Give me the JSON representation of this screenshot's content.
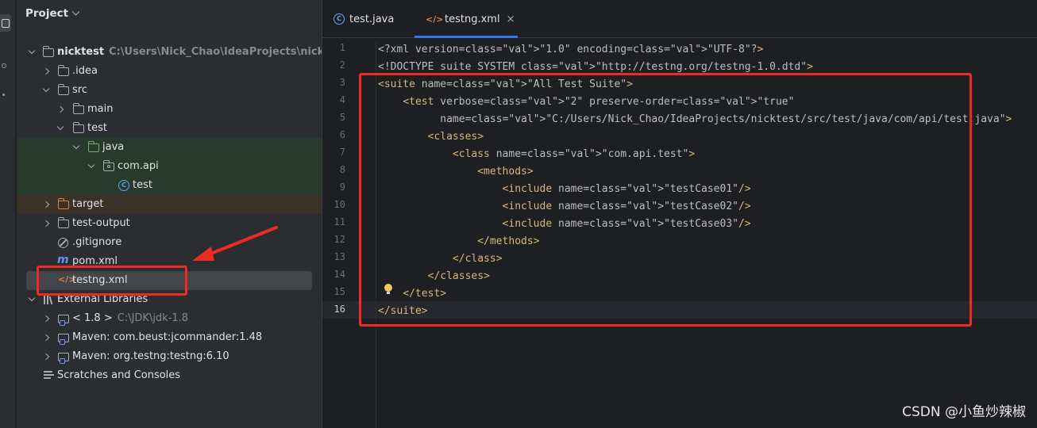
{
  "project_panel": {
    "title": "Project",
    "tree": [
      {
        "label": "nicktest",
        "hint": "C:\\Users\\Nick_Chao\\IdeaProjects\\nicktest"
      },
      {
        "label": ".idea"
      },
      {
        "label": "src"
      },
      {
        "label": "main"
      },
      {
        "label": "test"
      },
      {
        "label": "java"
      },
      {
        "label": "com.api"
      },
      {
        "label": "test"
      },
      {
        "label": "target"
      },
      {
        "label": "test-output"
      },
      {
        "label": ".gitignore"
      },
      {
        "label": "pom.xml"
      },
      {
        "label": "testng.xml"
      },
      {
        "label": "External Libraries"
      },
      {
        "label": "< 1.8 >",
        "hint": "C:\\JDK\\jdk-1.8"
      },
      {
        "label": "Maven: com.beust:jcommander:1.48"
      },
      {
        "label": "Maven: org.testng:testng:6.10"
      },
      {
        "label": "Scratches and Consoles"
      }
    ]
  },
  "editor": {
    "tabs": [
      {
        "label": "test.java",
        "icon": "class-icon"
      },
      {
        "label": "testng.xml",
        "icon": "xml-icon",
        "active": true
      }
    ],
    "current_line": 16,
    "lines": [
      {
        "n": "1",
        "text": "<?xml version=\"1.0\" encoding=\"UTF-8\"?>"
      },
      {
        "n": "2",
        "text": "<!DOCTYPE suite SYSTEM \"http://testng.org/testng-1.0.dtd\">"
      },
      {
        "n": "3",
        "text": "<suite name=\"All Test Suite\">"
      },
      {
        "n": "4",
        "text": "    <test verbose=\"2\" preserve-order=\"true\""
      },
      {
        "n": "5",
        "text": "          name=\"C:/Users/Nick_Chao/IdeaProjects/nicktest/src/test/java/com/api/test.java\">"
      },
      {
        "n": "6",
        "text": "        <classes>"
      },
      {
        "n": "7",
        "text": "            <class name=\"com.api.test\">"
      },
      {
        "n": "8",
        "text": "                <methods>"
      },
      {
        "n": "9",
        "text": "                    <include name=\"testCase01\"/>"
      },
      {
        "n": "10",
        "text": "                    <include name=\"testCase02\"/>"
      },
      {
        "n": "11",
        "text": "                    <include name=\"testCase03\"/>"
      },
      {
        "n": "12",
        "text": "                </methods>"
      },
      {
        "n": "13",
        "text": "            </class>"
      },
      {
        "n": "14",
        "text": "        </classes>"
      },
      {
        "n": "15",
        "text": "    </test>"
      },
      {
        "n": "16",
        "text": "</suite>"
      }
    ]
  },
  "watermark": "CSDN @小鱼炒辣椒",
  "colors": {
    "annotation_red": "#ee2a24",
    "accent": "#3574f0",
    "xml_tag": "#d5b778",
    "xml_value": "#6aab73"
  }
}
